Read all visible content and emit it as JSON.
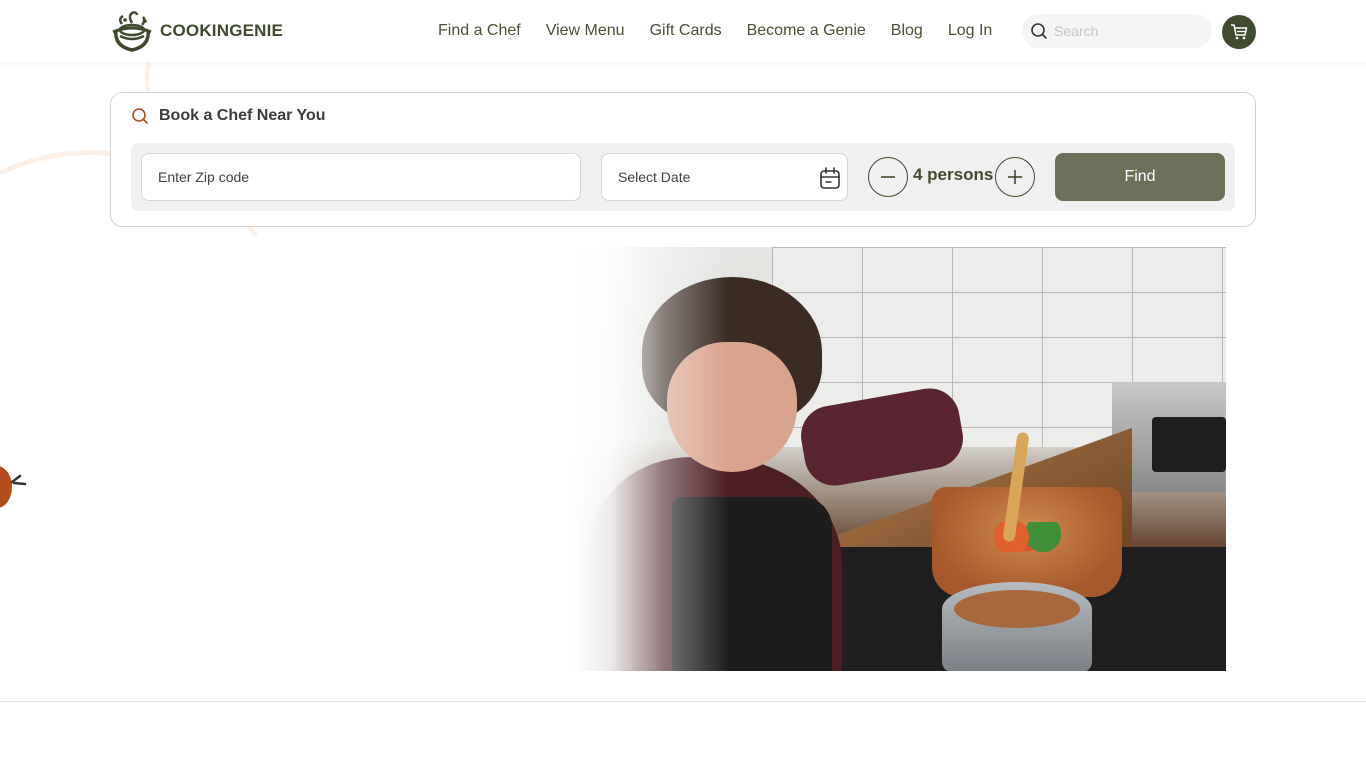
{
  "brand": {
    "name": "COOKINGENIE",
    "primary_color": "#3f4a2e",
    "accent_color": "#b24e1e",
    "button_color": "#6b7158"
  },
  "nav": {
    "items": [
      {
        "label": "Find a Chef"
      },
      {
        "label": "View Menu"
      },
      {
        "label": "Gift Cards"
      },
      {
        "label": "Become a Genie"
      },
      {
        "label": "Blog"
      },
      {
        "label": "Log In"
      }
    ],
    "search_placeholder": "Search",
    "search_icon": "search-icon",
    "cart_icon": "cart-icon"
  },
  "booking": {
    "title": "Book a Chef Near You",
    "title_icon": "search-icon",
    "zip_placeholder": "Enter Zip code",
    "zip_value": "",
    "date_label": "Select Date",
    "date_icon": "calendar-icon",
    "guests_count": 4,
    "guests_label": "4 persons",
    "decrement_icon": "minus-icon",
    "increment_icon": "plus-icon",
    "find_label": "Find"
  },
  "hero": {
    "image_alt": "Chef cooking vegetables in a copper pan at a home stove"
  }
}
